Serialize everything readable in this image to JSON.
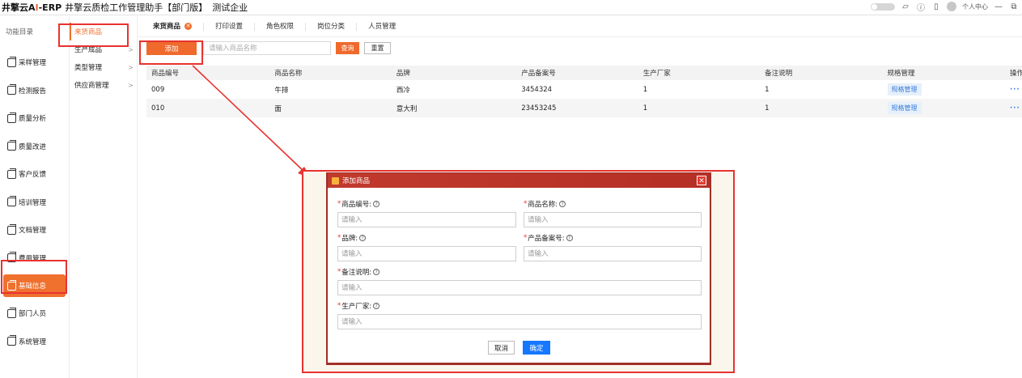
{
  "header": {
    "logo_prefix": "井擎云A",
    "logo_ai": "I",
    "logo_suffix": "-ERP",
    "app_title": "井擎云质检工作管理助手【部门版】",
    "company": "测试企业",
    "user_center": "个人中心"
  },
  "sidebar": {
    "heading": "功能目录",
    "items": [
      {
        "label": "采样管理"
      },
      {
        "label": "检测报告"
      },
      {
        "label": "质量分析"
      },
      {
        "label": "质量改进"
      },
      {
        "label": "客户反馈"
      },
      {
        "label": "培训管理"
      },
      {
        "label": "文档管理"
      },
      {
        "label": "费用管理"
      },
      {
        "label": "基础信息"
      },
      {
        "label": "部门人员"
      },
      {
        "label": "系统管理"
      }
    ]
  },
  "submenu": {
    "items": [
      {
        "label": "来货商品"
      },
      {
        "label": "生产成品"
      },
      {
        "label": "类型管理"
      },
      {
        "label": "供应商管理"
      }
    ]
  },
  "tabs": [
    {
      "label": "来货商品"
    },
    {
      "label": "打印设置"
    },
    {
      "label": "角色权限"
    },
    {
      "label": "岗位分类"
    },
    {
      "label": "人员管理"
    }
  ],
  "toolbar": {
    "add_label": "添加",
    "search_placeholder": "请输入商品名称",
    "query_label": "查询",
    "reset_label": "重置"
  },
  "table": {
    "columns": [
      "商品编号",
      "商品名称",
      "品牌",
      "产品备案号",
      "生产厂家",
      "备注说明",
      "规格管理",
      "操作"
    ],
    "rows": [
      {
        "code": "009",
        "name": "牛排",
        "brand": "西冷",
        "record_no": "3454324",
        "maker": "1",
        "note": "1",
        "spec": "规格管理",
        "ops": "···"
      },
      {
        "code": "010",
        "name": "面",
        "brand": "意大利",
        "record_no": "23453245",
        "maker": "1",
        "note": "1",
        "spec": "规格管理",
        "ops": "···"
      }
    ]
  },
  "modal": {
    "title": "添加商品",
    "close": "✕",
    "fields": {
      "code_label": "商品编号:",
      "name_label": "商品名称:",
      "brand_label": "品牌:",
      "record_label": "产品备案号:",
      "note_label": "备注说明:",
      "maker_label": "生产厂家:",
      "placeholder": "请输入"
    },
    "cancel_label": "取消",
    "ok_label": "确定"
  },
  "colors": {
    "accent": "#ef6a2c",
    "annotation": "#e8332f",
    "primary_blue": "#1677ff",
    "modal_header": "#c13a2d"
  }
}
